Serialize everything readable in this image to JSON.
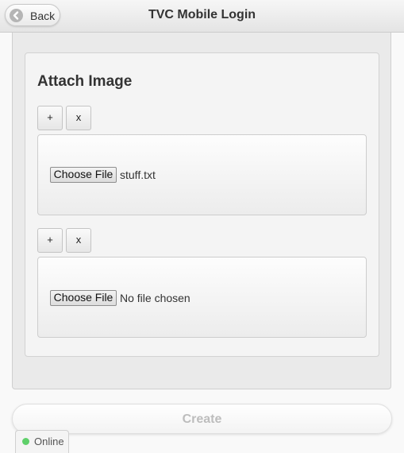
{
  "header": {
    "back_label": "Back",
    "title": "TVC Mobile Login"
  },
  "form": {
    "section_title": "Attach Image",
    "attachments": [
      {
        "add_label": "+",
        "remove_label": "x",
        "choose_label": "Choose File",
        "file_name": "stuff.txt"
      },
      {
        "add_label": "+",
        "remove_label": "x",
        "choose_label": "Choose File",
        "file_name": "No file chosen"
      }
    ],
    "create_label": "Create"
  },
  "status": {
    "label": "Online",
    "color": "#5fd06a"
  },
  "icons": {
    "back": "arrow-left-circle-icon",
    "status": "status-dot-icon"
  }
}
